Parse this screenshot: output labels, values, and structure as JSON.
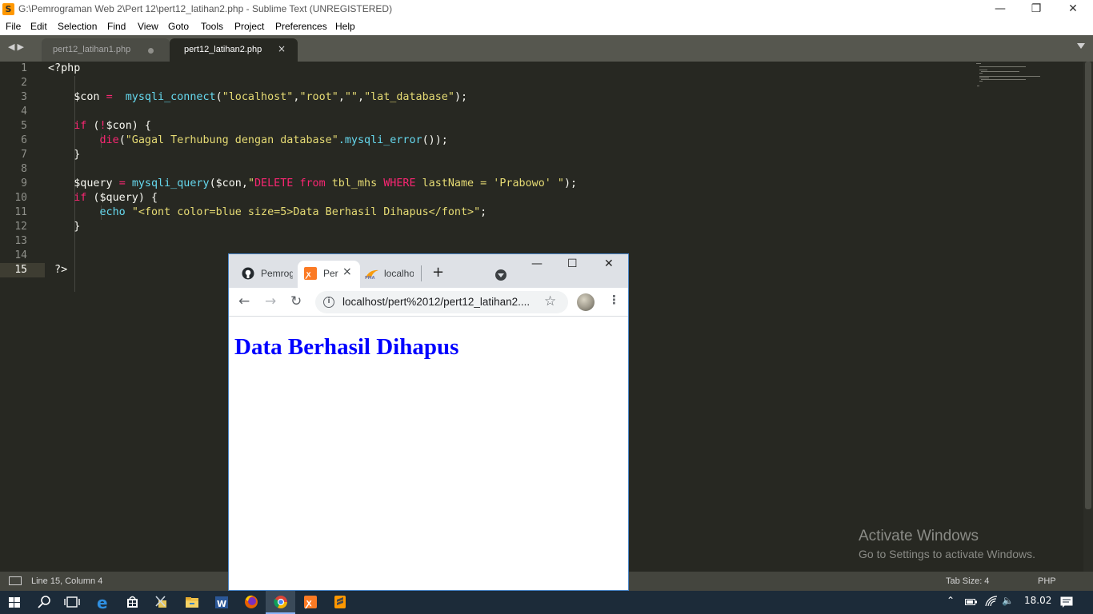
{
  "window": {
    "title": "G:\\Pemrograman Web 2\\Pert 12\\pert12_latihan2.php - Sublime Text (UNREGISTERED)",
    "controls": {
      "minimize": "—",
      "restore": "❐",
      "close": "✕"
    }
  },
  "menu": [
    "File",
    "Edit",
    "Selection",
    "Find",
    "View",
    "Goto",
    "Tools",
    "Project",
    "Preferences",
    "Help"
  ],
  "tabs": [
    {
      "label": "pert12_latihan1.php",
      "active": false,
      "modified": true
    },
    {
      "label": "pert12_latihan2.php",
      "active": true,
      "close": "×"
    }
  ],
  "editor": {
    "line_numbers": [
      "1",
      "2",
      "3",
      "4",
      "5",
      "6",
      "7",
      "8",
      "9",
      "10",
      "11",
      "12",
      "13",
      "14",
      "15"
    ],
    "active_line": "15",
    "code": [
      "<?php",
      "",
      "    $con =  mysqli_connect(\"localhost\",\"root\",\"\",\"lat_database\");",
      "",
      "    if (!$con) {",
      "        die(\"Gagal Terhubung dengan database\".mysqli_error());",
      "    }",
      "",
      "    $query = mysqli_query($con,\"DELETE from tbl_mhs WHERE lastName = 'Prabowo' \");",
      "    if ($query) {",
      "        echo \"<font color=blue size=5>Data Berhasil Dihapus</font>\";",
      "    }",
      "",
      "",
      " ?>"
    ]
  },
  "watermark": {
    "title": "Activate Windows",
    "subtitle": "Go to Settings to activate Windows."
  },
  "status": {
    "position": "Line 15, Column 4",
    "tab_size": "Tab Size: 4",
    "syntax": "PHP"
  },
  "browser": {
    "tabs": [
      {
        "label": "Pemrog",
        "icon": "github-icon"
      },
      {
        "label": "Per",
        "icon": "xampp-icon",
        "active": true,
        "close": "×"
      },
      {
        "label": "localho",
        "icon": "phpmyadmin-icon"
      }
    ],
    "new_tab": "+",
    "controls": {
      "minimize": "—",
      "maximize": "☐",
      "close": "✕"
    },
    "url": "localhost/pert%2012/pert12_latihan2....",
    "page_heading": "Data Berhasil Dihapus",
    "heading_color": "#0000ff"
  },
  "taskbar": {
    "clock": "18.02",
    "apps": [
      "windows-start",
      "search",
      "task-view",
      "edge",
      "store",
      "snipping-tool",
      "file-explorer",
      "word",
      "firefox",
      "chrome",
      "xampp",
      "sublime-text"
    ]
  },
  "colors": {
    "editor_bg": "#272822",
    "keyword": "#f92672",
    "function": "#66d9ef",
    "string": "#e6db74",
    "text": "#f8f8f2"
  }
}
